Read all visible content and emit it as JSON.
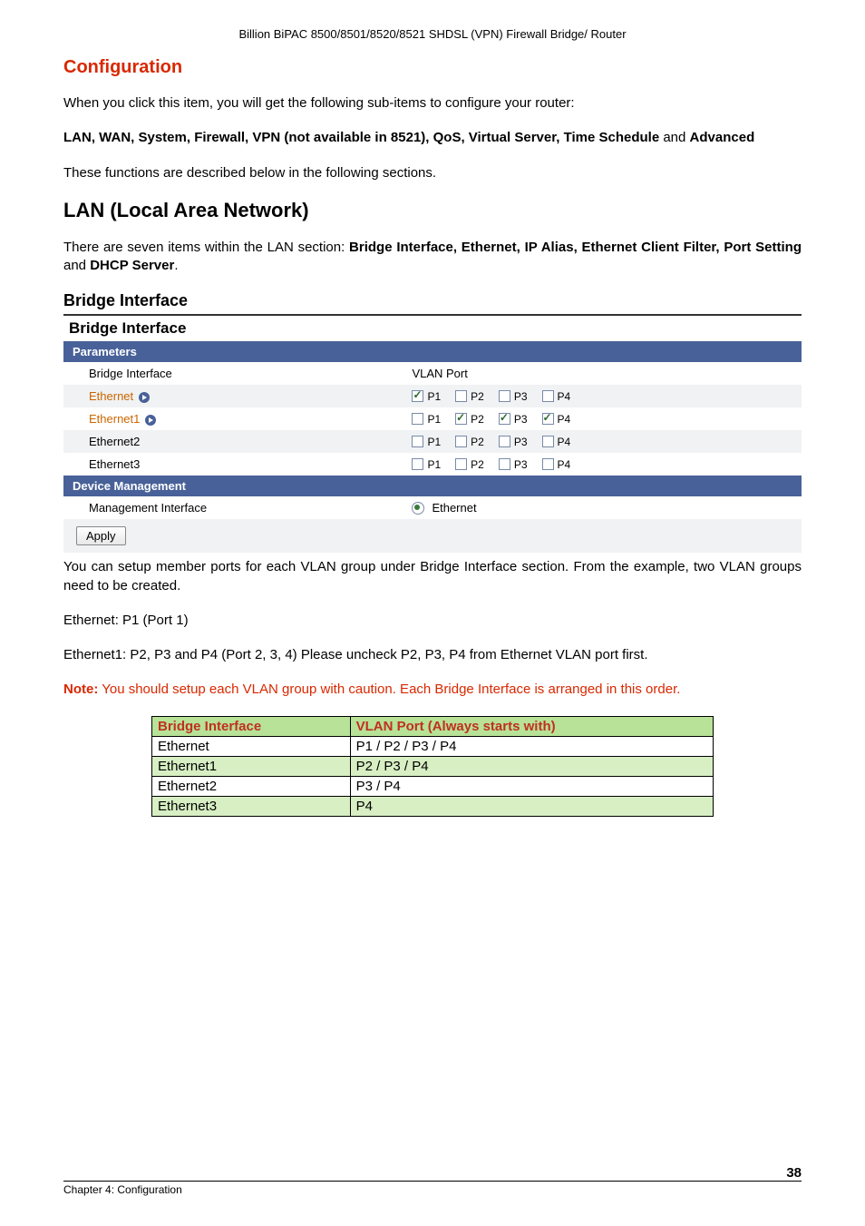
{
  "header": {
    "doc_title": "Billion BiPAC 8500/8501/8520/8521 SHDSL (VPN) Firewall Bridge/ Router"
  },
  "sections": {
    "config_heading": "Configuration",
    "config_intro": "When you click this item, you will get the following sub-items to configure your router:",
    "config_items_prefix": "LAN, WAN, System, Firewall, VPN (not available in 8521), QoS, Virtual Server, Time Schedule",
    "config_items_and": " and ",
    "config_items_last": "Advanced",
    "config_followup": "These functions are described below in the following sections.",
    "lan_heading": "LAN (Local Area Network)",
    "lan_intro_pre": "There are seven items within the LAN section: ",
    "lan_intro_bold": "Bridge Interface, Ethernet, IP Alias, Ethernet Client Filter, Port Setting",
    "lan_intro_and": " and ",
    "lan_intro_last": "DHCP Server",
    "lan_intro_dot": ".",
    "bridge_heading": "Bridge Interface",
    "after_shot_p1": "You can setup member ports for each VLAN group under Bridge Interface section. From the example, two VLAN groups need to be created.",
    "after_shot_p2": "Ethernet: P1 (Port 1)",
    "after_shot_p3": "Ethernet1: P2, P3 and P4 (Port 2, 3, 4) Please uncheck P2, P3, P4 from Ethernet VLAN port first.",
    "note_label": "Note:",
    "note_text": " You should setup each VLAN group with caution. Each Bridge Interface is arranged in this order."
  },
  "screenshot": {
    "title": "Bridge Interface",
    "sub_parameters": "Parameters",
    "col_bridge": "Bridge Interface",
    "col_vlan": "VLAN Port",
    "rows": [
      {
        "name": "Ethernet",
        "link": true,
        "p1": true,
        "p2": false,
        "p3": false,
        "p4": false
      },
      {
        "name": "Ethernet1",
        "link": true,
        "p1": false,
        "p2": true,
        "p3": true,
        "p4": true
      },
      {
        "name": "Ethernet2",
        "link": false,
        "p1": false,
        "p2": false,
        "p3": false,
        "p4": false
      },
      {
        "name": "Ethernet3",
        "link": false,
        "p1": false,
        "p2": false,
        "p3": false,
        "p4": false
      }
    ],
    "port_labels": {
      "p1": "P1",
      "p2": "P2",
      "p3": "P3",
      "p4": "P4"
    },
    "sub_device": "Device Management",
    "mgmt_label": "Management Interface",
    "mgmt_value": "Ethernet",
    "apply": "Apply"
  },
  "order_table": {
    "h1": "Bridge Interface",
    "h2": "VLAN Port (Always starts with)",
    "rows": [
      {
        "b": "Ethernet",
        "v": "P1 / P2 / P3 / P4",
        "shade": false
      },
      {
        "b": "Ethernet1",
        "v": "P2 / P3 / P4",
        "shade": true
      },
      {
        "b": "Ethernet2",
        "v": "P3 / P4",
        "shade": false
      },
      {
        "b": "Ethernet3",
        "v": "P4",
        "shade": true
      }
    ]
  },
  "footer": {
    "chapter": "Chapter 4: Configuration",
    "page": "38"
  }
}
